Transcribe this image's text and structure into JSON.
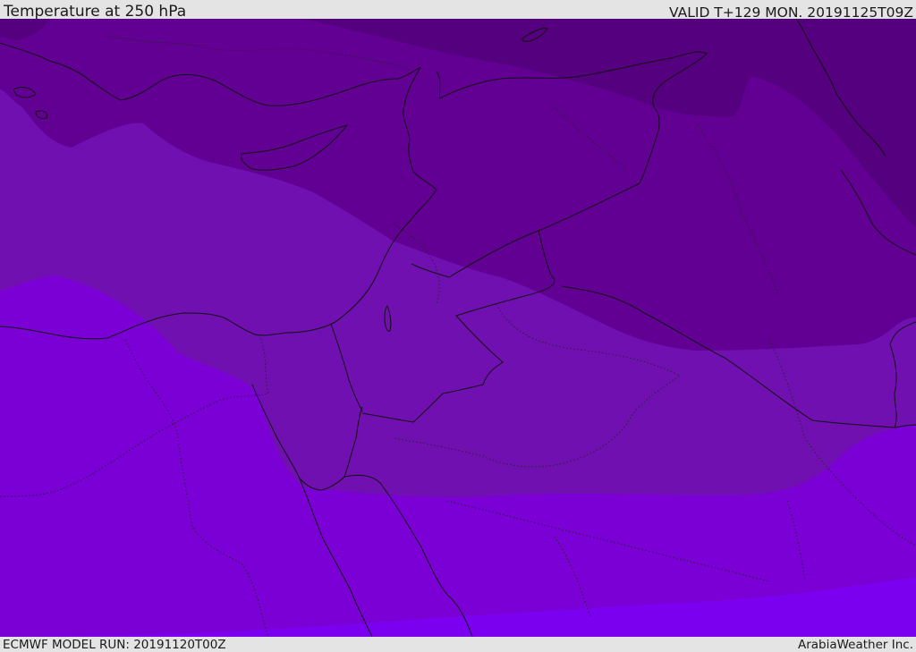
{
  "header": {
    "title": "Temperature at 250 hPa",
    "valid_time": "VALID T+129 MON. 20191125T09Z"
  },
  "footer": {
    "model_run": "ECMWF MODEL RUN: 20191120T00Z",
    "credit": "ArabiaWeather Inc."
  },
  "map": {
    "variable": "Temperature",
    "level": "250 hPa",
    "shading_bands": [
      {
        "band": 1,
        "color": "#55007f"
      },
      {
        "band": 2,
        "color": "#620094"
      },
      {
        "band": 3,
        "color": "#7010b0"
      },
      {
        "band": 4,
        "color": "#7b00d6"
      },
      {
        "band": 5,
        "color": "#7c00f0"
      }
    ]
  }
}
